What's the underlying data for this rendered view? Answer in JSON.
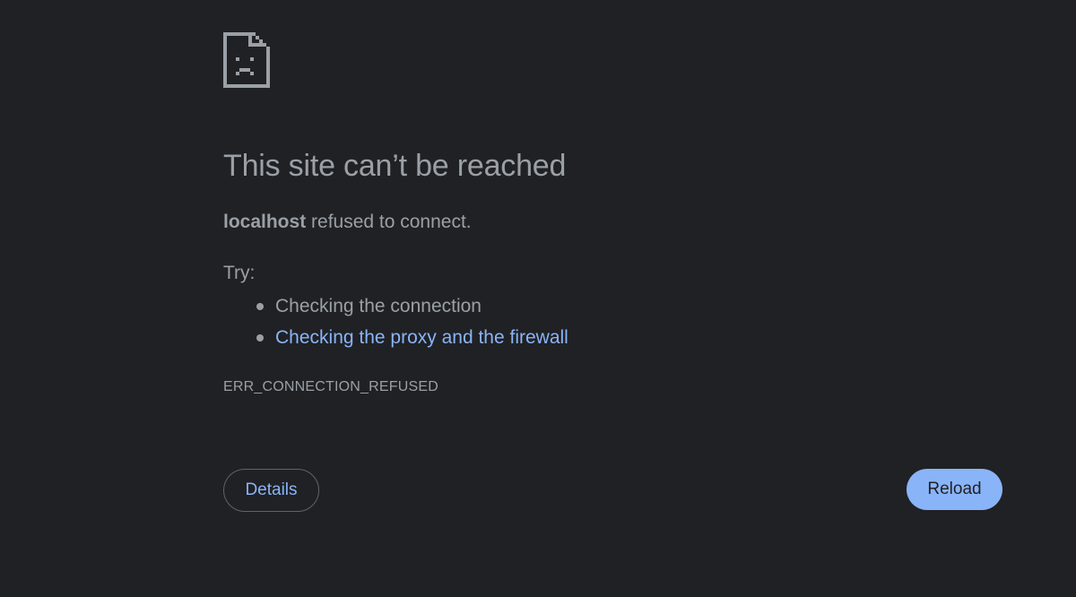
{
  "error_page": {
    "icon": "sad-page-icon",
    "headline": "This site can’t be reached",
    "message": {
      "host": "localhost",
      "text": " refused to connect."
    },
    "try_label": "Try:",
    "suggestions": [
      {
        "text": "Checking the connection",
        "is_link": false
      },
      {
        "text": "Checking the proxy and the firewall",
        "is_link": true
      }
    ],
    "error_code": "ERR_CONNECTION_REFUSED",
    "buttons": {
      "details_label": "Details",
      "reload_label": "Reload"
    }
  },
  "colors": {
    "background": "#202124",
    "text": "#9aa0a6",
    "link": "#8ab4f8",
    "reload_button": "#8ab4f8",
    "details_border": "#5f6368"
  }
}
